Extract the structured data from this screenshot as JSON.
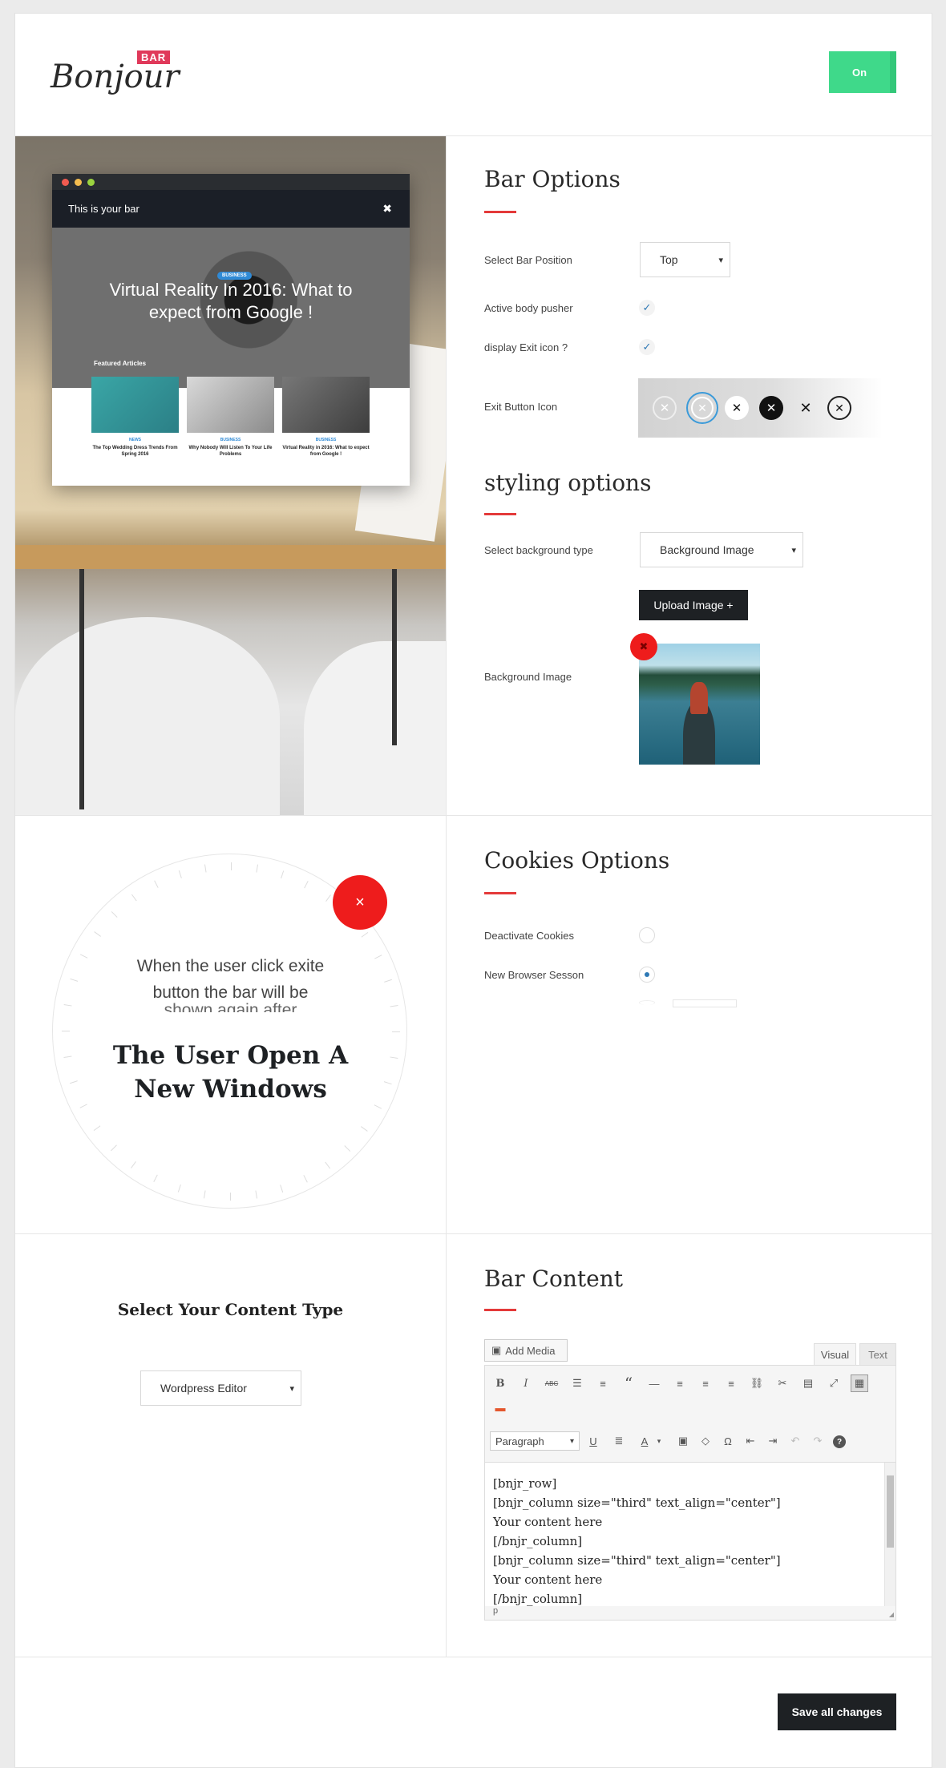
{
  "header": {
    "logo_text": "Bonjour",
    "logo_badge": "BAR",
    "toggle_label": "On"
  },
  "preview": {
    "bar_text": "This is your bar",
    "close_glyph": "✖",
    "badge": "BUSINESS",
    "headline": "Virtual Reality In 2016: What to expect from Google !",
    "featured_label": "Featured Articles",
    "cards": [
      {
        "tag": "NEWS",
        "title": "The Top Wedding Dress Trends From Spring 2016"
      },
      {
        "tag": "BUSINESS",
        "title": "Why Nobody Will Listen To Your Life Problems"
      },
      {
        "tag": "BUSINESS",
        "title": "Virtual Reality in 2016: What to expect from Google !"
      }
    ]
  },
  "bar_options": {
    "title": "Bar Options",
    "position_label": "Select Bar Position",
    "position_value": "Top",
    "pusher_label": "Active body pusher",
    "exit_label": "display Exit icon ?",
    "exit_icon_label": "Exit Button Icon"
  },
  "styling": {
    "title": "styling options",
    "bg_type_label": "Select background type",
    "bg_type_value": "Background Image",
    "upload_label": "Upload Image +",
    "bg_image_label": "Background Image",
    "remove_glyph": "✖"
  },
  "cookies": {
    "title": "Cookies Options",
    "deactivate_label": "Deactivate Cookies",
    "session_label": "New Browser Sesson",
    "dial_text_1": "When the user click exite",
    "dial_text_2": "button the bar will be",
    "dial_text_3": "shown again after",
    "dial_big_1": "The User Open A",
    "dial_big_2": "New Windows",
    "dial_close": "×"
  },
  "content": {
    "left_title": "Select Your Content Type",
    "type_value": "Wordpress Editor",
    "title": "Bar Content",
    "add_media": "Add Media",
    "tab_visual": "Visual",
    "tab_text": "Text",
    "format_value": "Paragraph",
    "editor_lines": [
      "[bnjr_row]",
      "[bnjr_column size=\"third\" text_align=\"center\"]",
      "Your content here",
      "[/bnjr_column]",
      "[bnjr_column size=\"third\" text_align=\"center\"]",
      "Your content here",
      "[/bnjr_column]"
    ],
    "status_path": "p"
  },
  "footer": {
    "save_label": "Save all changes"
  },
  "colors": {
    "accent_red": "#e43a3a",
    "toggle_green": "#3fd98a",
    "dark": "#1e2124",
    "check_blue": "#2e79b5"
  }
}
